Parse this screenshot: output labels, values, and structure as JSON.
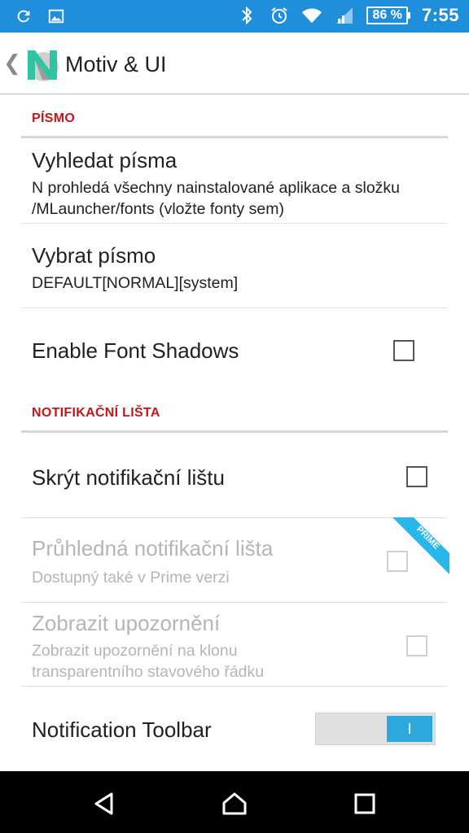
{
  "status_bar": {
    "left_icons": [
      "sync-icon",
      "image-icon"
    ],
    "right_icons": [
      "bluetooth-icon",
      "alarm-icon",
      "wifi-icon",
      "signal-icon"
    ],
    "battery": "86 %",
    "time": "7:55"
  },
  "app_bar": {
    "title": "Motiv & UI",
    "logo_letter": "N"
  },
  "sections": {
    "font": {
      "header": "PÍSMO",
      "search": {
        "title": "Vyhledat písma",
        "summary": "N prohledá všechny nainstalované aplikace a složku /MLauncher/fonts (vložte fonty sem)"
      },
      "choose": {
        "title": "Vybrat písmo",
        "summary": "DEFAULT[NORMAL][system]"
      },
      "shadows": {
        "title": "Enable Font Shadows",
        "checked": false
      }
    },
    "notification": {
      "header": "NOTIFIKAČNÍ LIŠTA",
      "hide": {
        "title": "Skrýt notifikační lištu",
        "checked": false
      },
      "transparent": {
        "title": "Průhledná notifikační lišta",
        "summary": "Dostupný také v Prime verzi",
        "badge": "PRIME",
        "checked": false,
        "enabled": false
      },
      "show_alerts": {
        "title": "Zobrazit upozornění",
        "summary": "Zobrazit upozornění na klonu transparentního stavového řádku",
        "checked": false,
        "enabled": false
      },
      "toolbar": {
        "title": "Notification Toolbar",
        "toggle_label": "I",
        "on": true
      }
    }
  },
  "colors": {
    "status_bar": "#1f8fdc",
    "section_header": "#c4161c",
    "toggle_on": "#2ea7dd",
    "ribbon": "#29b6e8"
  },
  "nav_bar": {
    "icons": [
      "back-icon",
      "home-icon",
      "recents-icon"
    ]
  }
}
